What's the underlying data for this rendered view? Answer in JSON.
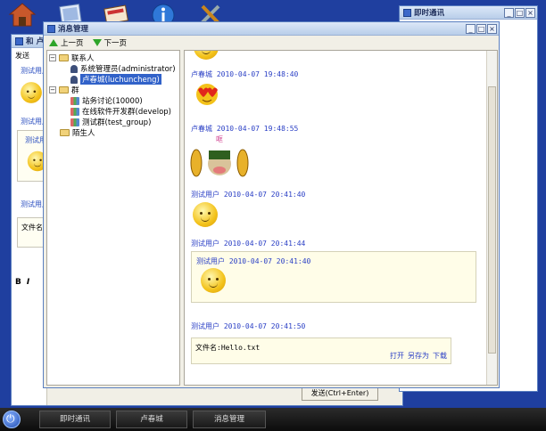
{
  "desktop_icons": [
    "home-icon",
    "documents-icon",
    "card-icon",
    "info-icon",
    "tools-icon"
  ],
  "back_window": {
    "title": "和 卢春",
    "send_label": "发送",
    "labels": [
      "测试用户",
      "测试用户",
      "测试用户",
      "测试用户"
    ],
    "file_label": "文件名",
    "format_bold": "B",
    "format_italic": "I",
    "send_button": "发送(Ctrl+Enter)"
  },
  "im_window": {
    "title": "即时通讯"
  },
  "msg_window": {
    "title": "消息管理",
    "toolbar": {
      "prev": "上一页",
      "next": "下一页"
    },
    "tree": {
      "contacts": "联系人",
      "admin": "系统管理员(administrator)",
      "luchun": "卢春城(luchuncheng)",
      "groups": "群",
      "g1": "站务讨论(10000)",
      "g2": "在线软件开发群(develop)",
      "g3": "测试群(test_group)",
      "strangers": "陌生人"
    },
    "messages": [
      {
        "sender": "卢春城",
        "time": "2010-04-07 19:48:40"
      },
      {
        "sender": "卢春城",
        "time": "2010-04-07 19:48:55"
      },
      {
        "sender": "测试用户",
        "time": "2010-04-07 20:41:40"
      },
      {
        "sender": "测试用户",
        "time": "2010-04-07 20:41:44"
      },
      {
        "sender": "测试用户",
        "time": "2010-04-07 20:41:50"
      }
    ],
    "quoted": {
      "sender": "测试用户",
      "time": "2010-04-07 20:41:40"
    },
    "file": {
      "name": "文件名:Hello.txt",
      "open": "打开",
      "save_as": "另存为",
      "download": "下载"
    }
  },
  "taskbar": {
    "items": [
      "即时通讯",
      "卢春城",
      "消息管理"
    ]
  }
}
